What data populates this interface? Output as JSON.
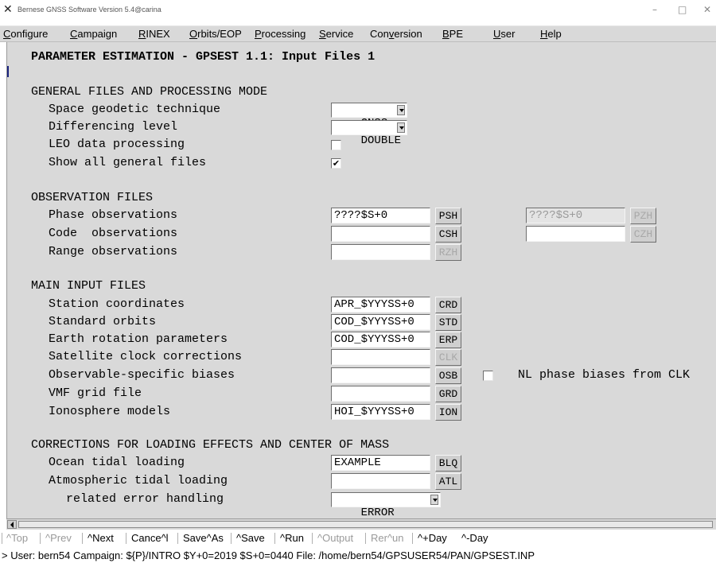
{
  "window": {
    "title": "Bernese GNSS Software Version 5.4@carina",
    "icon": "x-app-icon",
    "controls": {
      "minimize": "–",
      "maximize": "□",
      "close": "✕"
    }
  },
  "menu": [
    {
      "label": "Configure",
      "mnemonic": "C"
    },
    {
      "label": "Campaign",
      "mnemonic": "C"
    },
    {
      "label": "RINEX",
      "mnemonic": "R"
    },
    {
      "label": "Orbits/EOP",
      "mnemonic": "O"
    },
    {
      "label": "Processing",
      "mnemonic": "P"
    },
    {
      "label": "Service",
      "mnemonic": "S"
    },
    {
      "label": "Conversion",
      "mnemonic": "v"
    },
    {
      "label": "BPE",
      "mnemonic": "B"
    },
    {
      "label": "User",
      "mnemonic": "U"
    },
    {
      "label": "Help",
      "mnemonic": "H"
    }
  ],
  "panel": {
    "title": "PARAMETER ESTIMATION - GPSEST 1.1: Input Files 1",
    "general": {
      "heading": "GENERAL FILES AND PROCESSING MODE",
      "technique_label": "Space geodetic technique",
      "technique_value": "GNSS",
      "differencing_label": "Differencing level",
      "differencing_value": "DOUBLE",
      "leo_label": "LEO data processing",
      "leo_checked": false,
      "show_all_label": "Show all general files",
      "show_all_checked": true
    },
    "observation": {
      "heading": "OBSERVATION FILES",
      "phase_label": "Phase observations",
      "phase_value": "????$S+0",
      "phase_button": "PSH",
      "phase_zero_value": "????$S+0",
      "phase_zero_button": "PZH",
      "code_label": "Code  observations",
      "code_value": "",
      "code_button": "CSH",
      "code_zero_value": "",
      "code_zero_button": "CZH",
      "range_label": "Range observations",
      "range_value": "",
      "range_button": "RZH"
    },
    "main_input": {
      "heading": "MAIN INPUT FILES",
      "station_label": "Station coordinates",
      "station_value": "APR_$YYYSS+0",
      "station_button": "CRD",
      "orbits_label": "Standard orbits",
      "orbits_value": "COD_$YYYSS+0",
      "orbits_button": "STD",
      "erp_label": "Earth rotation parameters",
      "erp_value": "COD_$YYYSS+0",
      "erp_button": "ERP",
      "clock_label": "Satellite clock corrections",
      "clock_value": "",
      "clock_button": "CLK",
      "osb_label": "Observable-specific biases",
      "osb_value": "",
      "osb_button": "OSB",
      "nl_checked": false,
      "nl_label": "NL phase biases from CLK",
      "vmf_label": "VMF grid file",
      "vmf_value": "",
      "vmf_button": "GRD",
      "iono_label": "Ionosphere models",
      "iono_value": "HOI_$YYYSS+0",
      "iono_button": "ION"
    },
    "corrections": {
      "heading": "CORRECTIONS FOR LOADING EFFECTS AND CENTER OF MASS",
      "ocean_label": "Ocean tidal loading",
      "ocean_value": "EXAMPLE",
      "ocean_button": "BLQ",
      "atm_label": "Atmospheric tidal loading",
      "atm_value": "",
      "atm_button": "ATL",
      "error_label": "related error handling",
      "error_value": "ERROR"
    }
  },
  "buttons": {
    "top": "^Top",
    "prev": "^Prev",
    "next": "^Next",
    "cancel": "Cance^l",
    "save_as": "Save^As",
    "save": "^Save",
    "run": "^Run",
    "output": "^Output",
    "rerun": "Rer^un",
    "plus_day": "^+Day",
    "minus_day": "^-Day"
  },
  "status": "> User: bern54  Campaign: ${P}/INTRO  $Y+0=2019  $S+0=0440  File: /home/bern54/GPSUSER54/PAN/GPSEST.INP"
}
